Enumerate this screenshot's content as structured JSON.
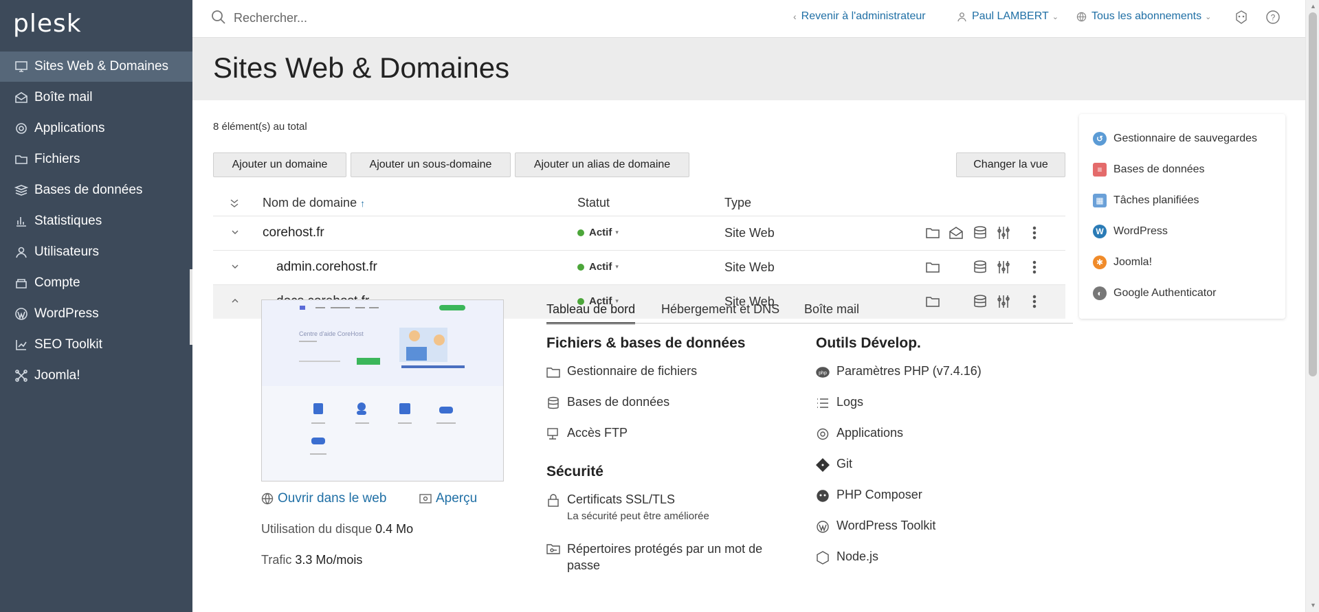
{
  "app": {
    "logo": "plesk"
  },
  "sidebar": {
    "items": [
      {
        "label": "Sites Web & Domaines",
        "icon": "monitor-icon",
        "active": true
      },
      {
        "label": "Boîte mail",
        "icon": "mail-icon"
      },
      {
        "label": "Applications",
        "icon": "gear-icon"
      },
      {
        "label": "Fichiers",
        "icon": "folder-icon"
      },
      {
        "label": "Bases de données",
        "icon": "database-icon"
      },
      {
        "label": "Statistiques",
        "icon": "chart-icon"
      },
      {
        "label": "Utilisateurs",
        "icon": "user-icon"
      },
      {
        "label": "Compte",
        "icon": "account-icon"
      },
      {
        "label": "WordPress",
        "icon": "wordpress-icon"
      },
      {
        "label": "SEO Toolkit",
        "icon": "seo-icon"
      },
      {
        "label": "Joomla!",
        "icon": "joomla-icon"
      }
    ]
  },
  "topbar": {
    "search_placeholder": "Rechercher...",
    "back_admin": "Revenir à l'administrateur",
    "user": "Paul LAMBERT",
    "subscriptions": "Tous les abonnements"
  },
  "page": {
    "title": "Sites Web & Domaines",
    "total": "8 élément(s) au total"
  },
  "toolbar": {
    "add_domain": "Ajouter un domaine",
    "add_subdomain": "Ajouter un sous-domaine",
    "add_alias": "Ajouter un alias de domaine",
    "change_view": "Changer la vue"
  },
  "table": {
    "headers": {
      "domain": "Nom de domaine",
      "sort": "↑",
      "status": "Statut",
      "type": "Type"
    },
    "rows": [
      {
        "domain": "corehost.fr",
        "status": "Actif",
        "type": "Site Web"
      },
      {
        "domain": "admin.corehost.fr",
        "status": "Actif",
        "type": "Site Web"
      },
      {
        "domain": "docs.corehost.fr",
        "status": "Actif",
        "type": "Site Web"
      }
    ]
  },
  "panel": {
    "open_web": "Ouvrir dans le web",
    "preview": "Aperçu",
    "disk_label": "Utilisation du disque",
    "disk_value": "0.4 Mo",
    "traffic_label": "Trafic",
    "traffic_value": "3.3 Mo/mois",
    "tabs": [
      "Tableau de bord",
      "Hébergement et DNS",
      "Boîte mail"
    ],
    "files_title": "Fichiers & bases de données",
    "files_items": [
      "Gestionnaire de fichiers",
      "Bases de données",
      "Accès FTP"
    ],
    "security_title": "Sécurité",
    "ssl": "Certificats SSL/TLS",
    "ssl_sub": "La sécurité peut être améliorée",
    "protected": "Répertoires protégés par un mot de passe",
    "dev_title": "Outils Dévelop.",
    "dev_items": [
      "Paramètres PHP (v7.4.16)",
      "Logs",
      "Applications",
      "Git",
      "PHP Composer",
      "WordPress Toolkit",
      "Node.js"
    ]
  },
  "widget": {
    "items": [
      {
        "label": "Gestionnaire de sauvegardes",
        "color": "#5b9bd5"
      },
      {
        "label": "Bases de données",
        "color": "#e46b6b"
      },
      {
        "label": "Tâches planifiées",
        "color": "#6aa0d8"
      },
      {
        "label": "WordPress",
        "color": "#2a7bb6"
      },
      {
        "label": "Joomla!",
        "color": "#f08b2a"
      },
      {
        "label": "Google Authenticator",
        "color": "#777777"
      }
    ]
  },
  "thumbnail": {
    "heading": "Centre d'aide CoreHost"
  },
  "colors": {
    "sidebar": "#3d4a5a",
    "accent": "#1f6fa5",
    "active_status": "#4ca63a"
  }
}
